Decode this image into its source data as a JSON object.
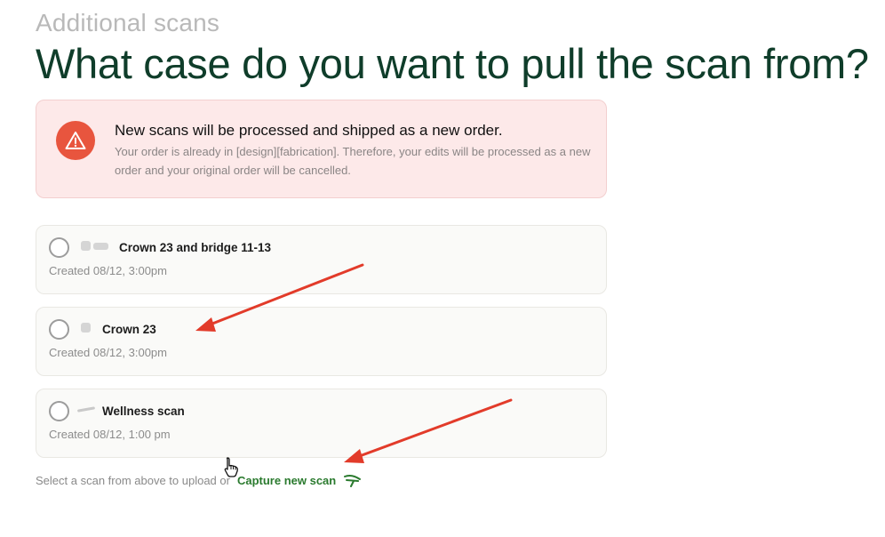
{
  "header": {
    "eyebrow": "Additional scans",
    "title": "What case do you want to pull the scan from?"
  },
  "alert": {
    "icon": "warning-triangle-icon",
    "title": "New scans will be processed and shipped as a new order.",
    "body": "Your order is already in [design][fabrication]. Therefore, your edits will be processed as a new order and your original order will be cancelled."
  },
  "scans": [
    {
      "name": "Crown 23 and bridge 11-13",
      "created": "Created 08/12, 3:00pm"
    },
    {
      "name": "Crown 23",
      "created": "Created 08/12, 3:00pm"
    },
    {
      "name": "Wellness scan",
      "created": "Created 08/12, 1:00 pm"
    }
  ],
  "footer": {
    "prompt": "Select a scan from above to upload or",
    "capture_label": "Capture new scan",
    "capture_icon": "scanner-wand-icon"
  },
  "colors": {
    "heading": "#0f3d2a",
    "alert_bg": "#fde9e9",
    "alert_icon": "#e8553e",
    "link": "#2a7a2e",
    "annotation_arrow": "#e23b2a"
  }
}
